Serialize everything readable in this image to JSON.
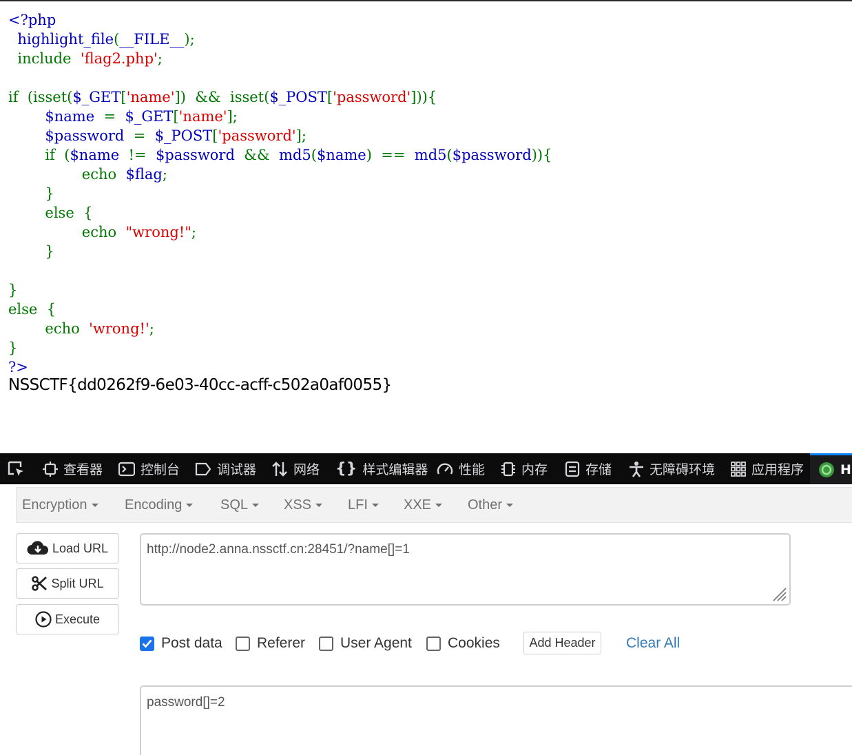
{
  "source_code": {
    "lines": [
      [
        {
          "t": "<?php",
          "c": "default"
        }
      ],
      [
        {
          "t": "  highlight_file",
          "c": "default"
        },
        {
          "t": "(",
          "c": "keyword"
        },
        {
          "t": "__FILE__",
          "c": "default"
        },
        {
          "t": ");",
          "c": "keyword"
        }
      ],
      [
        {
          "t": "  include  ",
          "c": "keyword"
        },
        {
          "t": "'flag2.php'",
          "c": "string"
        },
        {
          "t": ";",
          "c": "keyword"
        }
      ],
      [],
      [
        {
          "t": "if  (isset(",
          "c": "keyword"
        },
        {
          "t": "$_GET",
          "c": "default"
        },
        {
          "t": "[",
          "c": "keyword"
        },
        {
          "t": "'name'",
          "c": "string"
        },
        {
          "t": "])  &&  isset(",
          "c": "keyword"
        },
        {
          "t": "$_POST",
          "c": "default"
        },
        {
          "t": "[",
          "c": "keyword"
        },
        {
          "t": "'password'",
          "c": "string"
        },
        {
          "t": "])){",
          "c": "keyword"
        }
      ],
      [
        {
          "t": "        $name  ",
          "c": "default"
        },
        {
          "t": "=  ",
          "c": "keyword"
        },
        {
          "t": "$_GET",
          "c": "default"
        },
        {
          "t": "[",
          "c": "keyword"
        },
        {
          "t": "'name'",
          "c": "string"
        },
        {
          "t": "];",
          "c": "keyword"
        }
      ],
      [
        {
          "t": "        $password  ",
          "c": "default"
        },
        {
          "t": "=  ",
          "c": "keyword"
        },
        {
          "t": "$_POST",
          "c": "default"
        },
        {
          "t": "[",
          "c": "keyword"
        },
        {
          "t": "'password'",
          "c": "string"
        },
        {
          "t": "];",
          "c": "keyword"
        }
      ],
      [
        {
          "t": "        if  (",
          "c": "keyword"
        },
        {
          "t": "$name  ",
          "c": "default"
        },
        {
          "t": "!=  ",
          "c": "keyword"
        },
        {
          "t": "$password  ",
          "c": "default"
        },
        {
          "t": "&&  ",
          "c": "keyword"
        },
        {
          "t": "md5",
          "c": "default"
        },
        {
          "t": "(",
          "c": "keyword"
        },
        {
          "t": "$name",
          "c": "default"
        },
        {
          "t": ")  ==  ",
          "c": "keyword"
        },
        {
          "t": "md5",
          "c": "default"
        },
        {
          "t": "(",
          "c": "keyword"
        },
        {
          "t": "$password",
          "c": "default"
        },
        {
          "t": ")){",
          "c": "keyword"
        }
      ],
      [
        {
          "t": "                echo  ",
          "c": "keyword"
        },
        {
          "t": "$flag",
          "c": "default"
        },
        {
          "t": ";",
          "c": "keyword"
        }
      ],
      [
        {
          "t": "        }",
          "c": "keyword"
        }
      ],
      [
        {
          "t": "        else  {",
          "c": "keyword"
        }
      ],
      [
        {
          "t": "                echo  ",
          "c": "keyword"
        },
        {
          "t": "\"wrong!\"",
          "c": "string"
        },
        {
          "t": ";",
          "c": "keyword"
        }
      ],
      [
        {
          "t": "        }",
          "c": "keyword"
        }
      ],
      [],
      [
        {
          "t": "}",
          "c": "keyword"
        }
      ],
      [
        {
          "t": "else  {",
          "c": "keyword"
        }
      ],
      [
        {
          "t": "        echo  ",
          "c": "keyword"
        },
        {
          "t": "'wrong!'",
          "c": "string"
        },
        {
          "t": ";",
          "c": "keyword"
        }
      ],
      [
        {
          "t": "}",
          "c": "keyword"
        }
      ],
      [
        {
          "t": "?>",
          "c": "default"
        }
      ]
    ]
  },
  "flag_output": "NSSCTF{dd0262f9-6e03-40cc-acff-c502a0af0055}",
  "devtools": {
    "tabs": [
      "查看器",
      "控制台",
      "调试器",
      "网络",
      "样式编辑器",
      "性能",
      "内存",
      "存储",
      "无障碍环境",
      "应用程序"
    ],
    "active_tab_partial": "H"
  },
  "hackbar": {
    "menus": [
      "Encryption",
      "Encoding",
      "SQL",
      "XSS",
      "LFI",
      "XXE",
      "Other"
    ],
    "buttons": {
      "load": "Load URL",
      "split": "Split URL",
      "execute": "Execute"
    },
    "url_value": "http://node2.anna.nssctf.cn:28451/?name[]=1",
    "options": {
      "post_data": "Post data",
      "referer": "Referer",
      "user_agent": "User Agent",
      "cookies": "Cookies"
    },
    "option_states": {
      "post_data": true,
      "referer": false,
      "user_agent": false,
      "cookies": false
    },
    "add_header": "Add Header",
    "clear_all": "Clear All",
    "post_value": "password[]=2"
  },
  "colors": {
    "php_default": "#0000bb",
    "php_keyword": "#007700",
    "php_string": "#dd0000",
    "devtools_bg": "#0c0c0d",
    "accent": "#1a73e8"
  }
}
